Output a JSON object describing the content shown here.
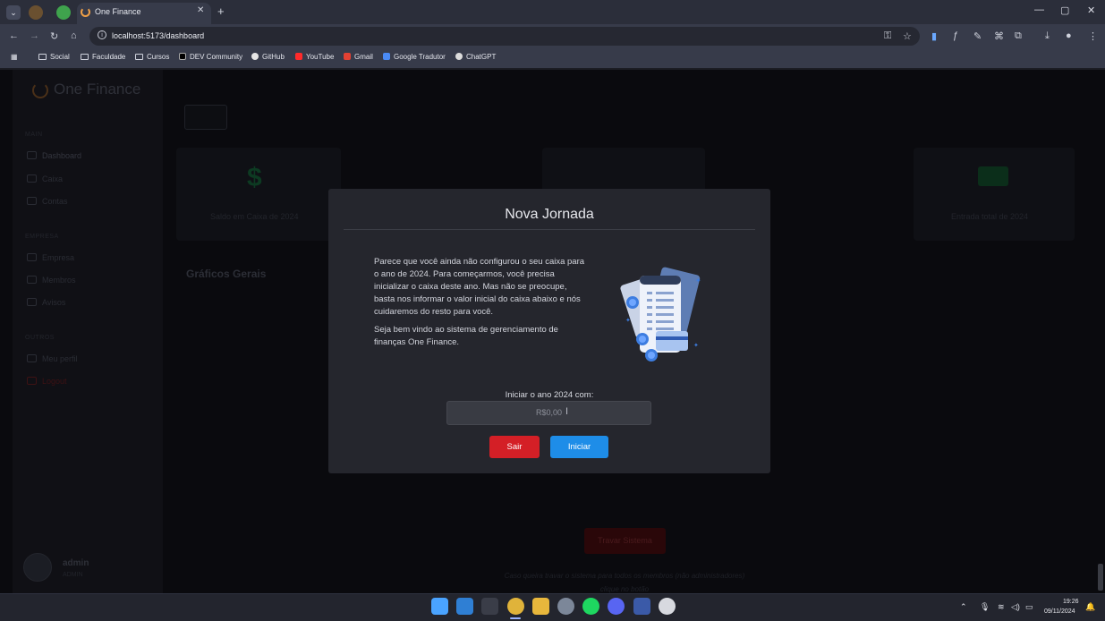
{
  "browser": {
    "tab_title": "One Finance",
    "tab_close": "✕",
    "new_tab": "+",
    "url": "localhost:5173/dashboard",
    "window_controls": [
      "—",
      "▢",
      "✕"
    ],
    "bookmarks": [
      "Social",
      "Faculdade",
      "Cursos",
      "DEV Community",
      "GitHub",
      "YouTube",
      "Gmail",
      "Google Tradutor",
      "ChatGPT"
    ]
  },
  "sidebar": {
    "brand": "One Finance",
    "sections": {
      "main": "MAIN",
      "company": "EMPRESA",
      "others": "OUTROS"
    },
    "items": {
      "dashboard": "Dashboard",
      "caixa": "Caixa",
      "contas": "Contas",
      "empresa": "Empresa",
      "membros": "Membros",
      "avisos": "Avisos",
      "perfil": "Meu perfil",
      "logout": "Logout"
    },
    "user": {
      "name": "admin",
      "role": "ADMIN"
    }
  },
  "dashboard": {
    "cards": {
      "saldo_label": "Saldo em Caixa de 2024",
      "entrada_label": "Entrada total de 2024"
    },
    "graphs_title": "Gráficos Gerais",
    "lock_button": "Travar Sistema",
    "lock_note": "Caso queira travar o sistema para todos os membros (não administradores) clique no botão"
  },
  "modal": {
    "title": "Nova Jornada",
    "paragraph1": "Parece que você ainda não configurou o seu caixa para o ano de 2024. Para começarmos, você precisa inicializar o caixa deste ano. Mas não se preocupe, basta nos informar o valor inicial do caixa abaixo e nós cuidaremos do resto para você.",
    "paragraph2": "Seja bem vindo ao sistema de gerenciamento de finanças One Finance.",
    "start_label": "Iniciar o ano 2024 com:",
    "input_placeholder": "R$0,00",
    "exit_button": "Sair",
    "start_button": "Iniciar"
  },
  "taskbar": {
    "time": "19:26",
    "date": "09/11/2024"
  },
  "colors": {
    "accent_blue": "#1e8de8",
    "danger_red": "#d41f26",
    "modal_bg": "#25262d",
    "green_icon": "#1f7a45"
  }
}
